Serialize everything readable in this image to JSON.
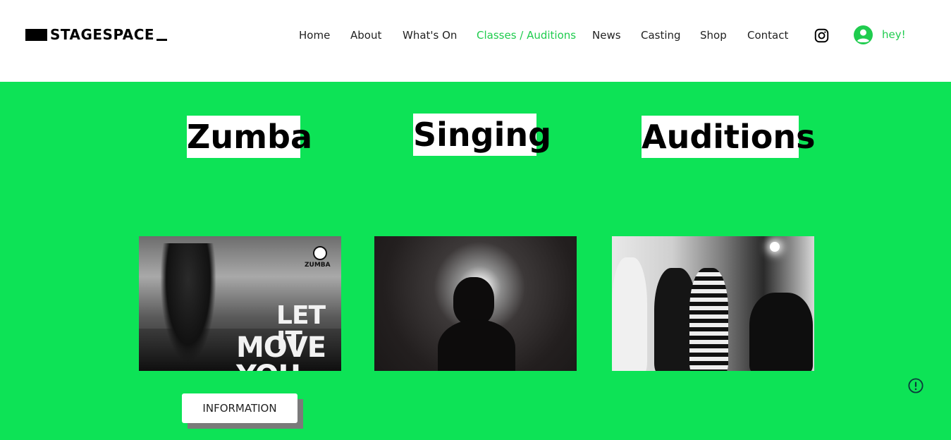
{
  "header": {
    "logo_text": "STAGESPACE",
    "nav": [
      {
        "label": "Home",
        "active": false
      },
      {
        "label": "About",
        "active": false
      },
      {
        "label": "What's On",
        "active": false
      },
      {
        "label": "Classes / Auditions",
        "active": true
      },
      {
        "label": "News",
        "active": false
      },
      {
        "label": "Casting",
        "active": false
      },
      {
        "label": "Shop",
        "active": false
      },
      {
        "label": "Contact",
        "active": false
      }
    ],
    "social_icon": "instagram-icon",
    "account": {
      "icon": "user-avatar-icon",
      "label": "hey!"
    }
  },
  "colors": {
    "accent_green": "#0de356",
    "nav_active": "#1fcc4e",
    "text_dark": "#222222"
  },
  "sections": [
    {
      "title": "Zumba",
      "image_text": {
        "brand": "ZUMBA",
        "slogan_line1": "LET IT",
        "slogan_line2": "MOVE YOU"
      }
    },
    {
      "title": "Singing"
    },
    {
      "title": "Auditions"
    }
  ],
  "buttons": {
    "information": "INFORMATION"
  },
  "widgets": {
    "alert_icon": "exclamation-circle-icon"
  }
}
